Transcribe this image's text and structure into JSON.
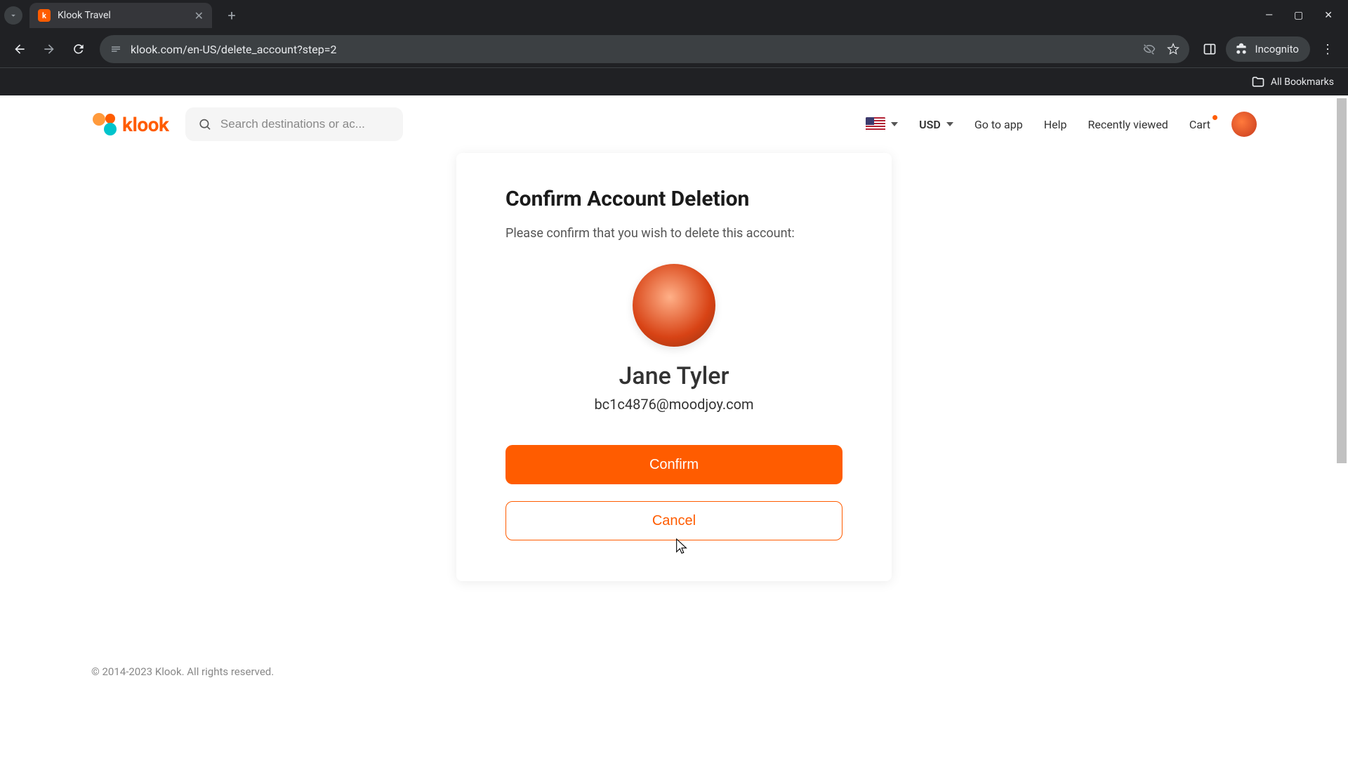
{
  "browser": {
    "tab_title": "Klook Travel",
    "url": "klook.com/en-US/delete_account?step=2",
    "incognito_label": "Incognito",
    "all_bookmarks": "All Bookmarks"
  },
  "header": {
    "logo_text": "klook",
    "search_placeholder": "Search destinations or ac...",
    "currency": "USD",
    "nav": {
      "go_to_app": "Go to app",
      "help": "Help",
      "recently_viewed": "Recently viewed",
      "cart": "Cart"
    }
  },
  "card": {
    "title": "Confirm Account Deletion",
    "description": "Please confirm that you wish to delete this account:",
    "user_name": "Jane Tyler",
    "user_email": "bc1c4876@moodjoy.com",
    "confirm_label": "Confirm",
    "cancel_label": "Cancel"
  },
  "footer": {
    "copyright": "© 2014-2023 Klook. All rights reserved."
  }
}
